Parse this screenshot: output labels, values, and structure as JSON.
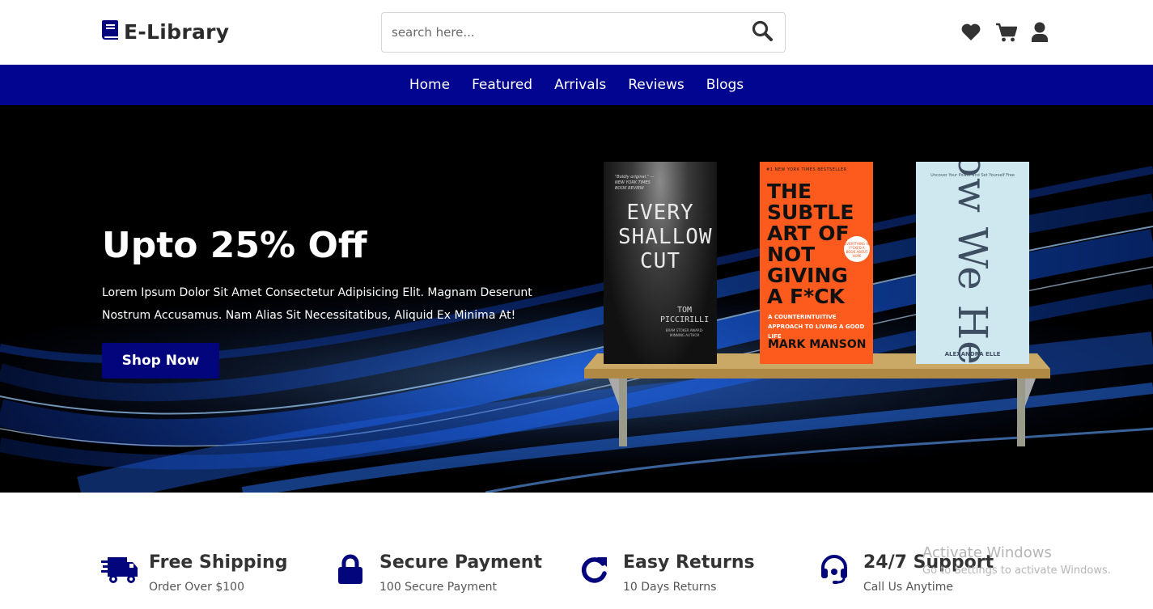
{
  "header": {
    "logo_text": "E-Library",
    "logo_icon": "book-icon",
    "search_placeholder": "search here...",
    "icons": [
      "heart-icon",
      "cart-icon",
      "user-icon"
    ]
  },
  "nav": {
    "items": [
      "Home",
      "Featured",
      "Arrivals",
      "Reviews",
      "Blogs"
    ]
  },
  "hero": {
    "title": "Upto 25% Off",
    "text": "Lorem Ipsum Dolor Sit Amet Consectetur Adipisicing Elit. Magnam Deserunt Nostrum Accusamus. Nam Alias Sit Necessitatibus, Aliquid Ex Minima At!",
    "button": "Shop Now",
    "books": [
      {
        "blurb": "\"Boldly original.\" —NEW YORK TIMES BOOK REVIEW",
        "title": "EVERY SHALLOW CUT",
        "author": "TOM PICCIRILLI",
        "note": "BRAM STOKER AWARD-WINNING AUTHOR"
      },
      {
        "top": "#1 NEW YORK TIMES BESTSELLER",
        "title": "THE SUBTLE ART OF NOT GIVING A F*CK",
        "badge": "EVERYTHING IS F*CKED A BOOK ABOUT HOPE",
        "subtitle": "A COUNTERINTUITIVE APPROACH TO LIVING A GOOD LIFE",
        "author": "MARK MANSON"
      },
      {
        "top": "Uncover Your Power and Set Yourself Free",
        "title": "How We Heal",
        "author": "ALEXANDRA ELLE"
      }
    ]
  },
  "features": [
    {
      "icon": "truck-icon",
      "title": "Free Shipping",
      "subtitle": "Order Over $100"
    },
    {
      "icon": "lock-icon",
      "title": "Secure Payment",
      "subtitle": "100 Secure Payment"
    },
    {
      "icon": "redo-icon",
      "title": "Easy Returns",
      "subtitle": "10 Days Returns"
    },
    {
      "icon": "headset-icon",
      "title": "24/7 Support",
      "subtitle": "Call Us Anytime"
    }
  ],
  "watermark": {
    "line1": "Activate Windows",
    "line2": "Go to Settings to activate Windows."
  },
  "colors": {
    "brand": "#02058f",
    "button": "#03057d",
    "hero_bg": "#000000",
    "book2": "#fd5a1e",
    "book3": "#cfe7ee"
  }
}
